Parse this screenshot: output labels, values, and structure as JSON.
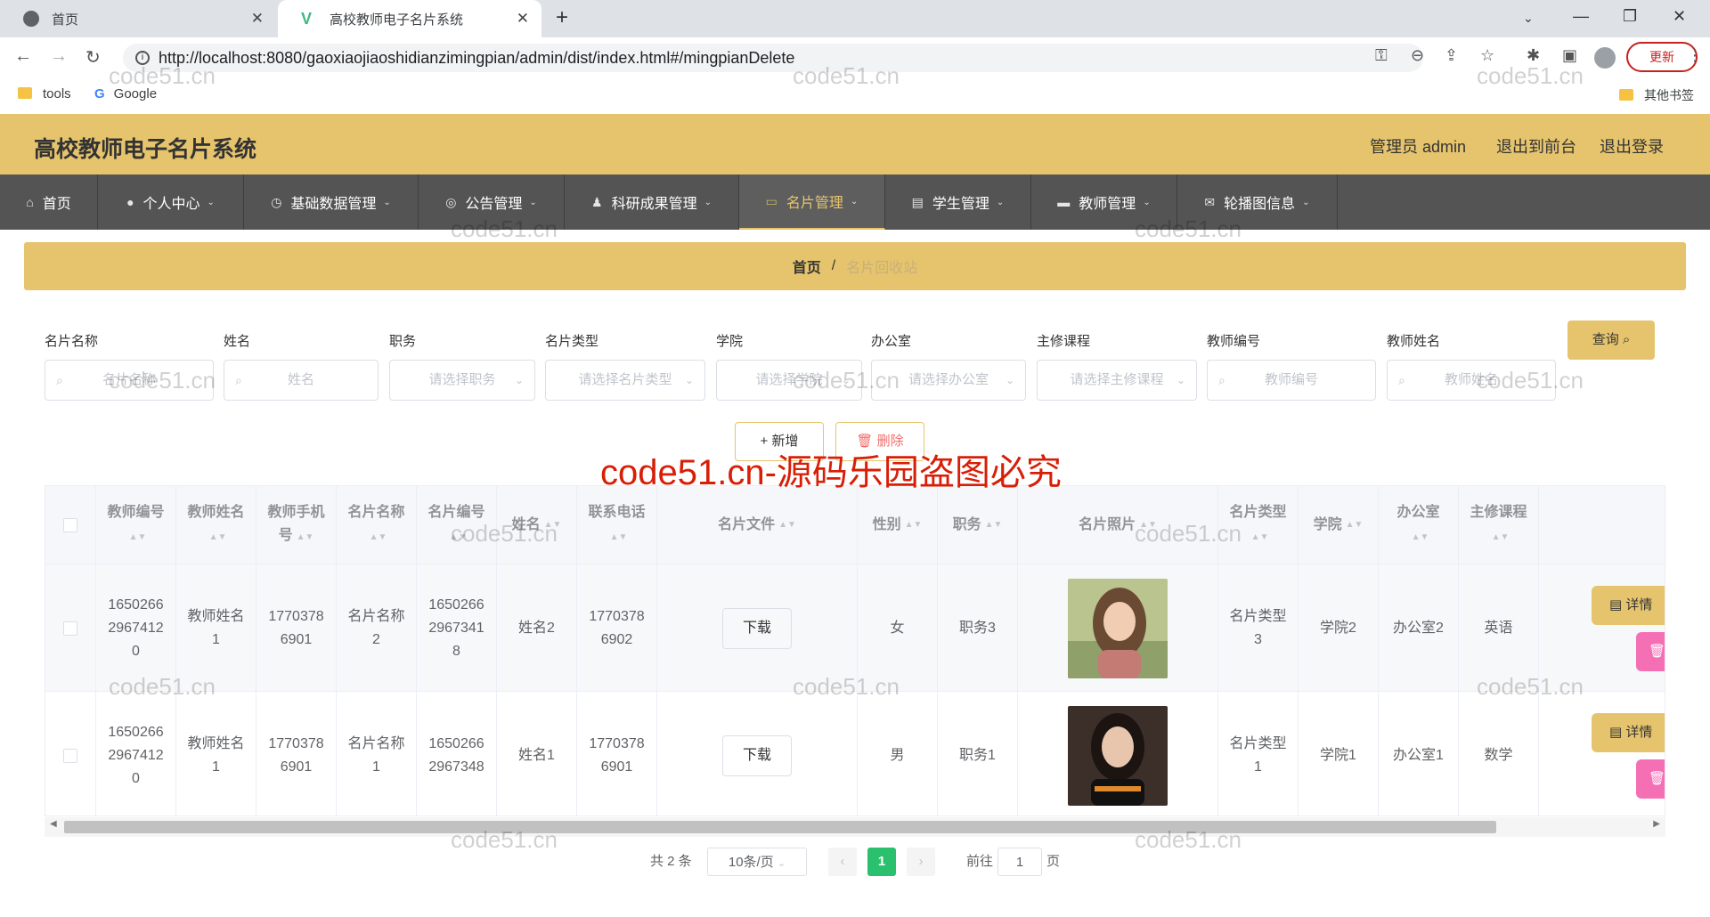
{
  "browser": {
    "tabs": [
      {
        "label": "首页",
        "active": false
      },
      {
        "label": "高校教师电子名片系统",
        "active": true
      }
    ],
    "new_tab": "+",
    "url": "http://localhost:8080/gaoxiaojiaoshidianzimingpian/admin/dist/index.html#/mingpianDelete",
    "update_label": "更新",
    "bookmarks": [
      "tools",
      "Google"
    ],
    "other_bookmarks": "其他书签"
  },
  "header": {
    "title": "高校教师电子名片系统",
    "user": "管理员 admin",
    "back_front": "退出到前台",
    "logout": "退出登录"
  },
  "menu": [
    {
      "label": "首页",
      "icon": "home-icon",
      "active": false,
      "dropdown": false
    },
    {
      "label": "个人中心",
      "icon": "user-icon",
      "active": false,
      "dropdown": true
    },
    {
      "label": "基础数据管理",
      "icon": "data-icon",
      "active": false,
      "dropdown": true
    },
    {
      "label": "公告管理",
      "icon": "notice-icon",
      "active": false,
      "dropdown": true
    },
    {
      "label": "科研成果管理",
      "icon": "research-icon",
      "active": false,
      "dropdown": true
    },
    {
      "label": "名片管理",
      "icon": "card-icon",
      "active": true,
      "dropdown": true
    },
    {
      "label": "学生管理",
      "icon": "student-icon",
      "active": false,
      "dropdown": true
    },
    {
      "label": "教师管理",
      "icon": "teacher-icon",
      "active": false,
      "dropdown": true
    },
    {
      "label": "轮播图信息",
      "icon": "carousel-icon",
      "active": false,
      "dropdown": true
    }
  ],
  "breadcrumb": {
    "home": "首页",
    "separator": "/",
    "current": "名片回收站"
  },
  "filters": [
    {
      "label": "名片名称",
      "placeholder": "名片名称",
      "type": "input"
    },
    {
      "label": "姓名",
      "placeholder": "姓名",
      "type": "input"
    },
    {
      "label": "职务",
      "placeholder": "请选择职务",
      "type": "select"
    },
    {
      "label": "名片类型",
      "placeholder": "请选择名片类型",
      "type": "select"
    },
    {
      "label": "学院",
      "placeholder": "请选择学院",
      "type": "select"
    },
    {
      "label": "办公室",
      "placeholder": "请选择办公室",
      "type": "select"
    },
    {
      "label": "主修课程",
      "placeholder": "请选择主修课程",
      "type": "select"
    },
    {
      "label": "教师编号",
      "placeholder": "教师编号",
      "type": "input"
    },
    {
      "label": "教师姓名",
      "placeholder": "教师姓名",
      "type": "input"
    }
  ],
  "search_button": "查询",
  "add_button": "新增",
  "delete_button": "删除",
  "watermark": "code51.cn",
  "watermark_banner": "code51.cn-源码乐园盗图必究",
  "table": {
    "columns": [
      "教师编号",
      "教师姓名",
      "教师手机号",
      "名片名称",
      "名片编号",
      "姓名",
      "联系电话",
      "名片文件",
      "性别",
      "职务",
      "名片照片",
      "名片类型",
      "学院",
      "办公室",
      "主修课程"
    ],
    "rows": [
      {
        "teacher_no": "16502662967412 0",
        "teacher_name": "教师姓名1",
        "teacher_phone": "17703786901",
        "card_name": "名片名称2",
        "card_no": "16502662967341 8",
        "name": "姓名2",
        "phone": "17703786902",
        "file": "下载",
        "gender": "女",
        "duty": "职务3",
        "card_type": "名片类型3",
        "college": "学院2",
        "office": "办公室2",
        "course": "英语"
      },
      {
        "teacher_no": "16502662967412 0",
        "teacher_name": "教师姓名1",
        "teacher_phone": "17703786901",
        "card_name": "名片名称1",
        "card_no": "16502662967348",
        "name": "姓名1",
        "phone": "17703786901",
        "file": "下载",
        "gender": "男",
        "duty": "职务1",
        "card_type": "名片类型1",
        "college": "学院1",
        "office": "办公室1",
        "course": "数学"
      }
    ],
    "detail_label": "详情"
  },
  "pagination": {
    "total": "共 2 条",
    "page_size": "10条/页",
    "current": "1",
    "goto_prefix": "前往",
    "goto_value": "1",
    "goto_suffix": "页"
  },
  "colors": {
    "accent": "#e6c46d",
    "menu_bg": "#545454",
    "pager_active": "#2ac06d",
    "delete": "#f56fb5",
    "banner": "#d81e06"
  }
}
